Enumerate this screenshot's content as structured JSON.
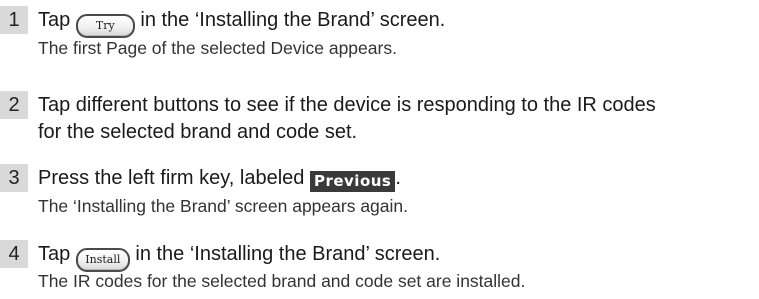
{
  "steps": [
    {
      "number": "1",
      "before": "Tap ",
      "button": {
        "label": "Try",
        "icon": "try-button-icon"
      },
      "after": " in the ‘Installing the Brand’ screen.",
      "result": "The first Page of the selected Device appears."
    },
    {
      "number": "2",
      "line1": "Tap different buttons to see if the device is responding to the IR codes",
      "line2": "for the selected brand and code set."
    },
    {
      "number": "3",
      "before": "Press the left firm key, labeled ",
      "key": {
        "label": "Previous"
      },
      "after": ".",
      "result": "The ‘Installing the Brand’ screen appears again."
    },
    {
      "number": "4",
      "before": "Tap ",
      "button": {
        "label": "Install",
        "icon": "install-button-icon"
      },
      "after": " in the ‘Installing the Brand’ screen.",
      "result": "The IR codes for the selected brand and code set are installed."
    }
  ],
  "colors": {
    "number_badge_bg": "#d9d9d9",
    "firm_key_bg": "#3a3a3a",
    "text": "#1a1a1a"
  }
}
